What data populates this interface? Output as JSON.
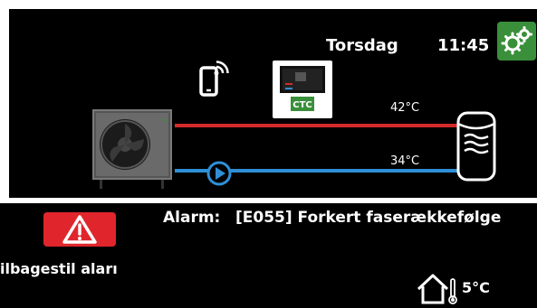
{
  "header": {
    "day": "Torsdag",
    "time": "11:45",
    "settings_icon": "gears-icon"
  },
  "system": {
    "supply_temp": "42°C",
    "return_temp": "34°C",
    "controller_logo": "CTC",
    "phone_icon": "smartphone-wifi-icon",
    "pump_icon": "circulation-pump-icon",
    "tank_icon": "tank-icon",
    "heatpump_icon": "heat-pump-icon"
  },
  "alarm": {
    "label": "Alarm:",
    "message": "[E055] Forkert faserækkefølge",
    "icon": "warning-icon",
    "reset_label": "ilbagestil aları"
  },
  "outdoor": {
    "temperature": "5°C",
    "icon": "house-thermometer-icon"
  },
  "colors": {
    "supply": "#d32a2a",
    "return": "#2f8fd6",
    "alarm": "#e0262c",
    "settings": "#3a8f3a"
  }
}
